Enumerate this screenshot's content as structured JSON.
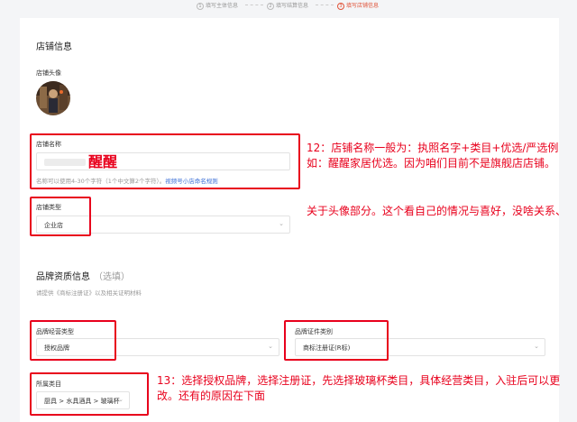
{
  "steps": [
    {
      "num": "1",
      "label": "填写主体信息"
    },
    {
      "num": "2",
      "label": "填写结算信息"
    },
    {
      "num": "3",
      "label": "填写店铺信息"
    }
  ],
  "shop_info": {
    "title": "店铺信息",
    "avatar_label": "店铺头像",
    "name_label": "店铺名称",
    "name_value": "醒醒",
    "name_hint": "名称可以使用4-30个字符（1个中文算2个字符）。",
    "name_hint_link": "视频号小店命名规则",
    "type_label": "店铺类型",
    "type_value": "企业店"
  },
  "brand_info": {
    "title": "品牌资质信息",
    "title_optional": "（选填）",
    "hint": "请提供《商标注册证》以及相关证明材料",
    "biz_type_label": "品牌经营类型",
    "biz_type_value": "授权品牌",
    "cert_type_label": "品牌证件类别",
    "cert_type_value": "商标注册证(R标)",
    "category_label": "所属类目",
    "category_value": "厨具 > 水具酒具 > 玻璃杯"
  },
  "annotations": {
    "note12": "12：店铺名称一般为：执照名字+类目+优选/严选例如：醒醒家居优选。因为咱们目前不是旗舰店店铺。",
    "note_avatar": "关于头像部分。这个看自己的情况与喜好，没啥关系、",
    "note13": "13：选择授权品牌，选择注册证，先选择玻璃杯类目，具体经营类目，入驻后可以更改。还有的原因在下面"
  },
  "colors": {
    "accent": "#e0543a",
    "annotation_red": "#e8001c",
    "link": "#3b6fd6"
  }
}
